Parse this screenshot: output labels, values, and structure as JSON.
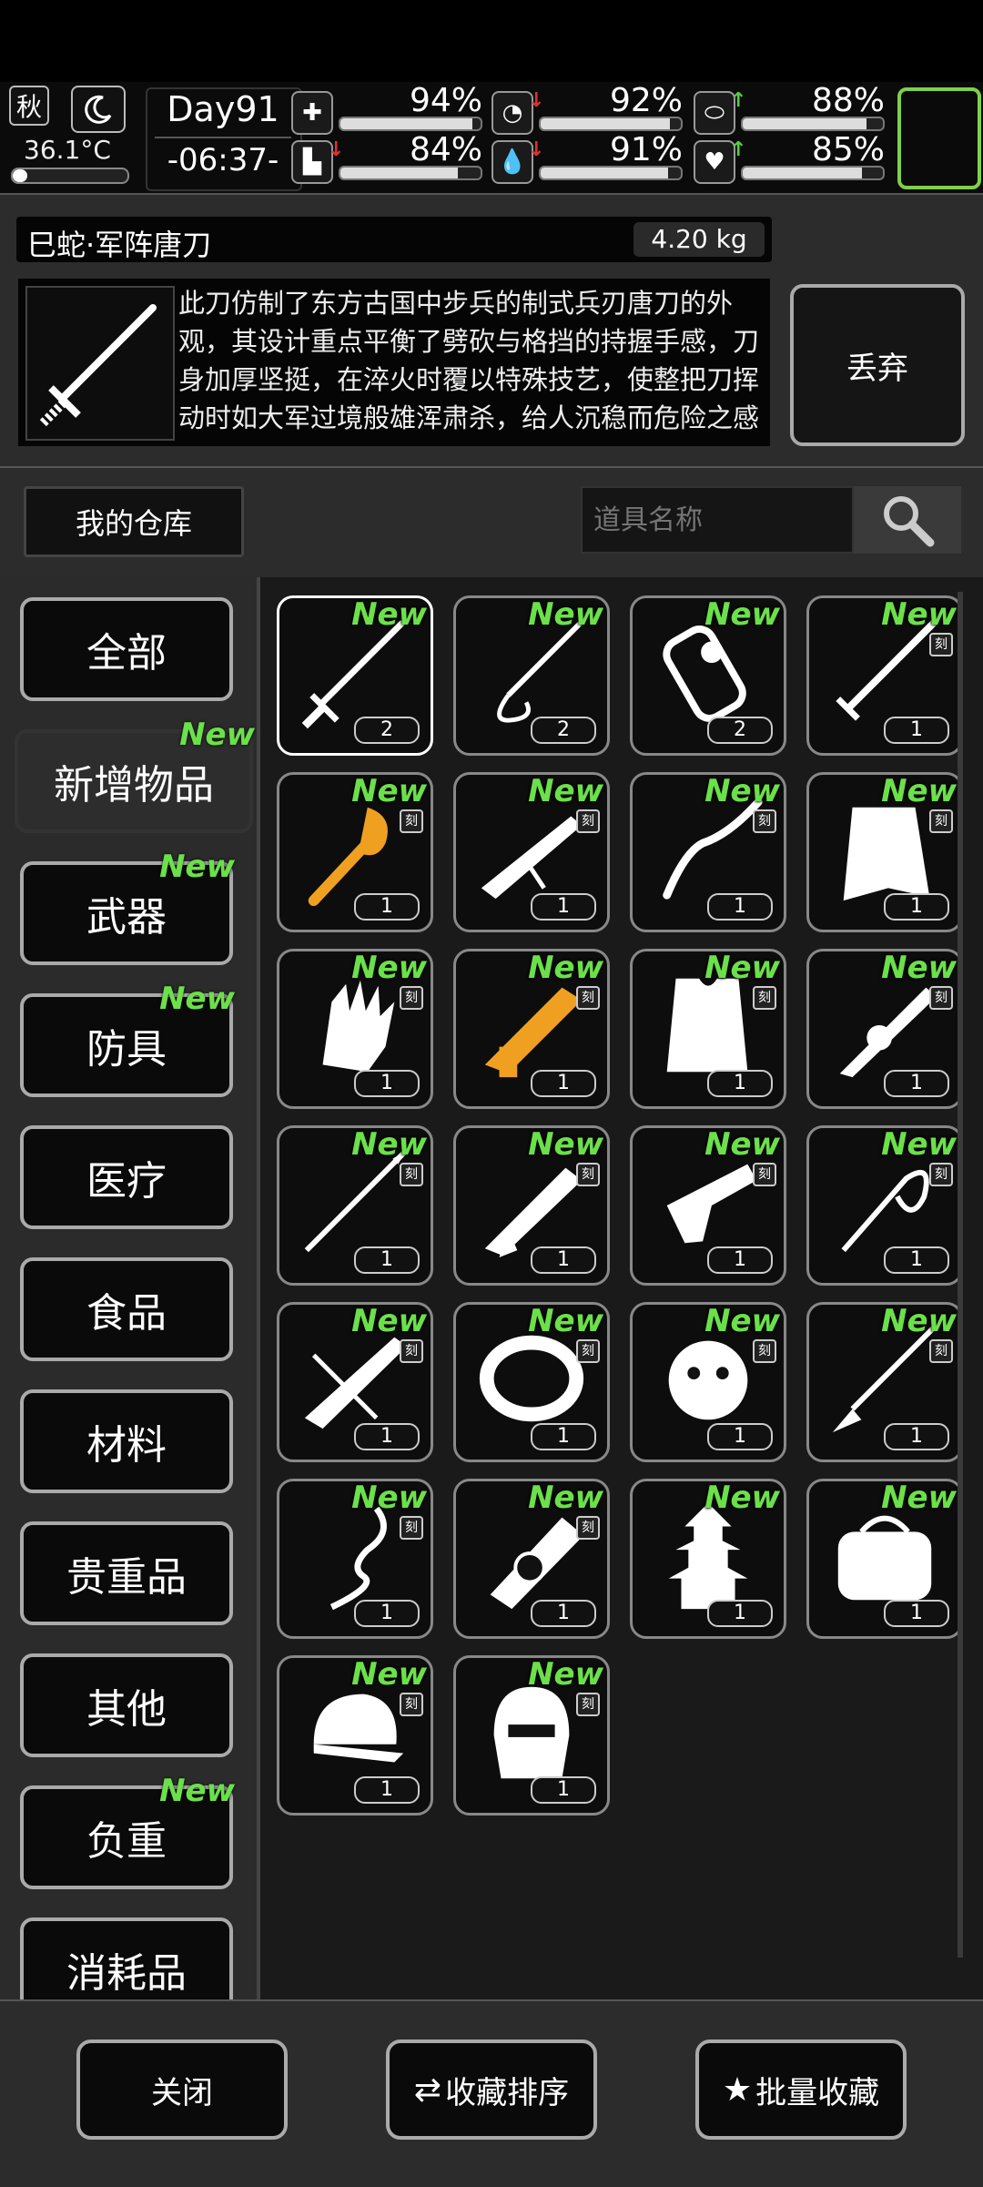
{
  "status": {
    "season": "秋",
    "temperature": "36.1°C",
    "day": "Day91",
    "time": "-06:37-",
    "stats": [
      {
        "name": "health",
        "value": "94%",
        "arrow": ""
      },
      {
        "name": "hunger",
        "value": "92%",
        "arrow": "down"
      },
      {
        "name": "thirst",
        "value": "88%",
        "arrow": "up"
      },
      {
        "name": "stamina",
        "value": "84%",
        "arrow": "down"
      },
      {
        "name": "water",
        "value": "91%",
        "arrow": "down"
      },
      {
        "name": "mood",
        "value": "85%",
        "arrow": "up"
      }
    ]
  },
  "item": {
    "name": "巳蛇·军阵唐刀",
    "weight": "4.20 kg",
    "description": "此刀仿制了东方古国中步兵的制式兵刃唐刀的外观，其设计重点平衡了劈砍与格挡的持握手感，刀身加厚坚挺，在淬火时覆以特殊技艺，使整把刀挥动时如大军过境般雄浑肃杀，给人沉稳而危险之感",
    "drop_label": "丢弃"
  },
  "storage": {
    "title": "我的仓库",
    "search_placeholder": "道具名称"
  },
  "categories": [
    {
      "label": "全部",
      "new": false,
      "active": false
    },
    {
      "label": "新增物品",
      "new": true,
      "active": true
    },
    {
      "label": "武器",
      "new": true,
      "active": false
    },
    {
      "label": "防具",
      "new": true,
      "active": false
    },
    {
      "label": "医疗",
      "new": false,
      "active": false
    },
    {
      "label": "食品",
      "new": false,
      "active": false
    },
    {
      "label": "材料",
      "new": false,
      "active": false
    },
    {
      "label": "贵重品",
      "new": false,
      "active": false
    },
    {
      "label": "其他",
      "new": false,
      "active": false
    },
    {
      "label": "负重",
      "new": true,
      "active": false
    },
    {
      "label": "消耗品",
      "new": false,
      "active": false
    }
  ],
  "new_tag": "New",
  "engrave_tag": "刻",
  "items": [
    {
      "icon": "tang-sword-icon",
      "count": "2",
      "engraved": false,
      "color": "#ffffff"
    },
    {
      "icon": "whip-sword-icon",
      "count": "2",
      "engraved": false,
      "color": "#ffffff"
    },
    {
      "icon": "armguard-icon",
      "count": "2",
      "engraved": false,
      "color": "#ffffff"
    },
    {
      "icon": "long-sword-icon",
      "count": "1",
      "engraved": true,
      "color": "#ffffff"
    },
    {
      "icon": "dragon-mace-icon",
      "count": "1",
      "engraved": true,
      "color": "#f0a020"
    },
    {
      "icon": "rifle-icon",
      "count": "1",
      "engraved": true,
      "color": "#ffffff"
    },
    {
      "icon": "curved-blade-icon",
      "count": "1",
      "engraved": true,
      "color": "#ffffff"
    },
    {
      "icon": "cloak-icon",
      "count": "1",
      "engraved": true,
      "color": "#ffffff"
    },
    {
      "icon": "gauntlet-icon",
      "count": "1",
      "engraved": true,
      "color": "#ffffff"
    },
    {
      "icon": "golden-gun-icon",
      "count": "1",
      "engraved": true,
      "color": "#f0a020"
    },
    {
      "icon": "vest-icon",
      "count": "1",
      "engraved": true,
      "color": "#ffffff"
    },
    {
      "icon": "ornate-rifle-icon",
      "count": "1",
      "engraved": true,
      "color": "#ffffff"
    },
    {
      "icon": "spear-icon",
      "count": "1",
      "engraved": true,
      "color": "#ffffff"
    },
    {
      "icon": "shotgun-icon",
      "count": "1",
      "engraved": true,
      "color": "#ffffff"
    },
    {
      "icon": "pistol-icon",
      "count": "1",
      "engraved": true,
      "color": "#ffffff"
    },
    {
      "icon": "chain-whip-icon",
      "count": "1",
      "engraved": true,
      "color": "#ffffff"
    },
    {
      "icon": "crossbow-icon",
      "count": "1",
      "engraved": true,
      "color": "#ffffff"
    },
    {
      "icon": "bracelet-icon",
      "count": "1",
      "engraved": true,
      "color": "#ffffff"
    },
    {
      "icon": "medusa-icon",
      "count": "1",
      "engraved": true,
      "color": "#ffffff"
    },
    {
      "icon": "spear-tassel-icon",
      "count": "1",
      "engraved": true,
      "color": "#ffffff"
    },
    {
      "icon": "serpent-staff-icon",
      "count": "1",
      "engraved": true,
      "color": "#ffffff"
    },
    {
      "icon": "heavy-gun-icon",
      "count": "1",
      "engraved": true,
      "color": "#ffffff"
    },
    {
      "icon": "pagoda-icon",
      "count": "1",
      "engraved": false,
      "color": "#ffffff"
    },
    {
      "icon": "bag-icon",
      "count": "1",
      "engraved": false,
      "color": "#ffffff"
    },
    {
      "icon": "cap-icon",
      "count": "1",
      "engraved": true,
      "color": "#ffffff"
    },
    {
      "icon": "helmet-icon",
      "count": "1",
      "engraved": true,
      "color": "#ffffff"
    }
  ],
  "footer": {
    "close_label": "关闭",
    "sort_label": "收藏排序",
    "batch_label": "批量收藏"
  }
}
